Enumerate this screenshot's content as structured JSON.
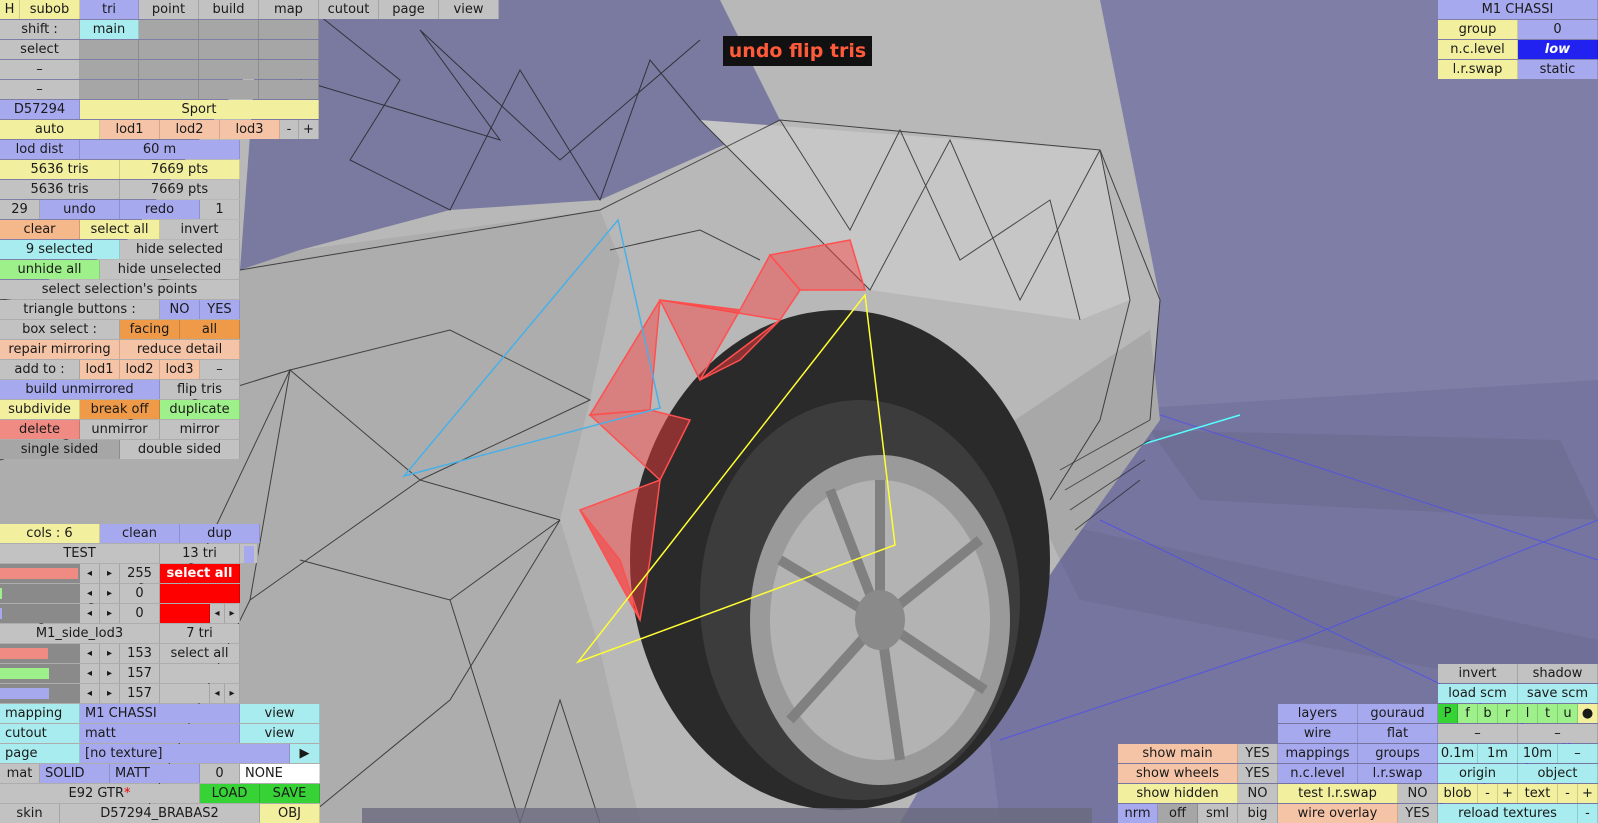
{
  "popup": {
    "message": "undo flip tris"
  },
  "topbar": {
    "h": "H",
    "tabs": [
      "subob",
      "tri",
      "point",
      "build",
      "map",
      "cutout",
      "page",
      "view"
    ]
  },
  "left": {
    "shift_label": "shift :",
    "shift_value": "main",
    "select_label": "select",
    "dash": "–",
    "model_id": "D57294",
    "model_name": "Sport",
    "auto": "auto",
    "lod1": "lod1",
    "lod2": "lod2",
    "lod3": "lod3",
    "minus": "-",
    "plus": "+",
    "lod_dist_label": "lod dist",
    "lod_dist_value": "60 m",
    "tris1": "5636 tris",
    "pts1": "7669 pts",
    "tris2": "5636 tris",
    "pts2": "7669 pts",
    "undo_count": "29",
    "undo": "undo",
    "redo": "redo",
    "redo_count": "1",
    "clear": "clear",
    "select_all": "select all",
    "invert": "invert",
    "selected": "9 selected",
    "hide_selected": "hide selected",
    "unhide_all": "unhide all",
    "hide_unselected": "hide unselected",
    "select_sel_points": "select selection's points",
    "triangle_buttons": "triangle buttons :",
    "no": "NO",
    "yes": "YES",
    "box_select": "box select :",
    "facing": "facing",
    "all": "all",
    "repair_mirroring": "repair mirroring",
    "reduce_detail": "reduce detail",
    "add_to": "add to :",
    "add_lod1": "lod1",
    "add_lod2": "lod2",
    "add_lod3": "lod3",
    "add_dash": "–",
    "build_unmirrored": "build unmirrored",
    "flip_tris": "flip tris",
    "subdivide": "subdivide",
    "break_off": "break off",
    "duplicate": "duplicate",
    "delete": "delete",
    "unmirror": "unmirror",
    "mirror": "mirror",
    "single_sided": "single sided",
    "double_sided": "double sided"
  },
  "cols": {
    "cols": "cols : 6",
    "clean": "clean",
    "dup": "dup",
    "arrow_left": "◂",
    "arrow_right": "▸",
    "mat1": {
      "name": "TEST",
      "tri": "13 tri",
      "r": "255",
      "g": "0",
      "b": "0",
      "button": "select all"
    },
    "mat2": {
      "name": "M1_side_lod3",
      "tri": "7 tri",
      "r": "153",
      "g": "157",
      "b": "157",
      "button": "select all"
    }
  },
  "bottom_left": {
    "mapping_label": "mapping",
    "mapping_value": "M1 CHASSI",
    "view": "view",
    "cutout_label": "cutout",
    "cutout_value": "matt",
    "page_label": "page",
    "page_value": "[no texture]",
    "play": "▶",
    "mat": "mat",
    "solid": "SOLID",
    "matt": "MATT",
    "zero": "0",
    "none": "NONE",
    "car_name": "E92 GTR",
    "asterisk": "*",
    "load": "LOAD",
    "save": "SAVE",
    "skin_label": "skin",
    "skin_value": "D57294_BRABAS2",
    "obj": "OBJ"
  },
  "top_right": {
    "title": "M1 CHASSI",
    "group_label": "group",
    "group_value": "0",
    "nc_level_label": "n.c.level",
    "nc_level_value": "low",
    "lr_swap_label": "l.r.swap",
    "lr_swap_value": "static"
  },
  "bottom_right": {
    "invert": "invert",
    "shadow": "shadow",
    "load_scm": "load scm",
    "save_scm": "save scm",
    "letters": [
      "P",
      "f",
      "b",
      "r",
      "l",
      "t",
      "u",
      "●"
    ],
    "layers": "layers",
    "gouraud": "gouraud",
    "wire": "wire",
    "flat": "flat",
    "dash": "–",
    "mappings": "mappings",
    "groups": "groups",
    "m01": "0.1m",
    "m1": "1m",
    "m10": "10m",
    "m_dash": "–",
    "nc_level": "n.c.level",
    "lr_swap": "l.r.swap",
    "origin": "origin",
    "object": "object",
    "test_lr_swap": "test l.r.swap",
    "no": "NO",
    "blob": "blob",
    "minus": "-",
    "plus": "+",
    "text": "text",
    "wire_overlay": "wire overlay",
    "yes": "YES",
    "reload_textures": "reload textures",
    "dot": "-",
    "show_main": "show main",
    "show_wheels": "show wheels",
    "show_hidden": "show hidden",
    "nrm": "nrm",
    "off": "off",
    "sml": "sml",
    "big": "big"
  },
  "colors": {
    "bg": "#7f7fa6",
    "body": "#b5b5b5",
    "selected": "#ff3a3a",
    "yellow": "#ffff33",
    "cyan": "#48b0e8"
  }
}
